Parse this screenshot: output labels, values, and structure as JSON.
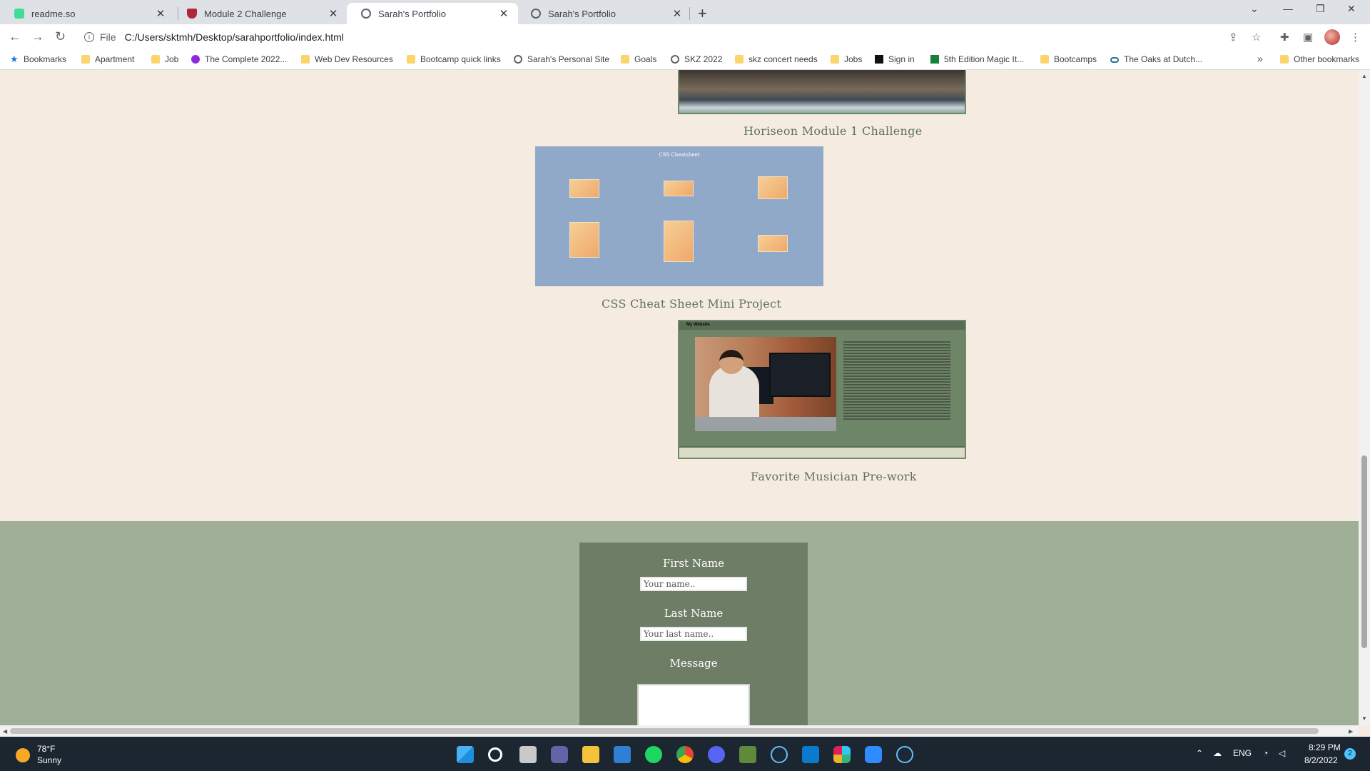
{
  "browser": {
    "tabs": [
      {
        "title": "readme.so",
        "icon": "readme-icon"
      },
      {
        "title": "Module 2 Challenge",
        "icon": "shield-icon"
      },
      {
        "title": "Sarah's Portfolio",
        "icon": "globe-icon",
        "active": true
      },
      {
        "title": "Sarah's Portfolio",
        "icon": "globe-icon"
      }
    ],
    "address": {
      "scheme_label": "File",
      "url": "C:/Users/sktmh/Desktop/sarahportfolio/index.html"
    },
    "bookmarks": [
      {
        "label": "Bookmarks",
        "icon": "star-icon"
      },
      {
        "label": "Apartment",
        "icon": "folder-icon"
      },
      {
        "label": "Job",
        "icon": "folder-icon"
      },
      {
        "label": "The Complete 2022...",
        "icon": "purple-logo-icon"
      },
      {
        "label": "Web Dev Resources",
        "icon": "folder-icon"
      },
      {
        "label": "Bootcamp quick links",
        "icon": "folder-icon"
      },
      {
        "label": "Sarah's Personal Site",
        "icon": "globe-icon"
      },
      {
        "label": "Goals",
        "icon": "folder-icon"
      },
      {
        "label": "SKZ 2022",
        "icon": "globe-icon"
      },
      {
        "label": "skz concert needs",
        "icon": "folder-icon"
      },
      {
        "label": "Jobs",
        "icon": "folder-icon"
      },
      {
        "label": "Sign in",
        "icon": "uw-logo-icon"
      },
      {
        "label": "5th Edition Magic It...",
        "icon": "sheets-icon"
      },
      {
        "label": "Bootcamps",
        "icon": "folder-icon"
      },
      {
        "label": "The Oaks at Dutch...",
        "icon": "link-icon"
      }
    ],
    "bookmarks_overflow": "»",
    "other_bookmarks": "Other bookmarks"
  },
  "portfolio": {
    "projects": [
      {
        "caption": "Horiseon Module 1 Challenge"
      },
      {
        "caption": "CSS Cheat Sheet Mini Project"
      },
      {
        "caption": "Favorite Musician Pre-work"
      }
    ],
    "thumb_cheatsheet_title": "CSS Cheatsheet",
    "thumb_site_title": "My Website"
  },
  "contact_form": {
    "first_name_label": "First Name",
    "first_name_placeholder": "Your name..",
    "last_name_label": "Last Name",
    "last_name_placeholder": "Your last name..",
    "message_label": "Message"
  },
  "taskbar": {
    "weather_temp": "78°F",
    "weather_desc": "Sunny",
    "lang": "ENG",
    "time": "8:29 PM",
    "date": "8/2/2022",
    "notification_count": "2"
  },
  "colors": {
    "page_bg": "#f5ebe0",
    "sage_accent": "#6e7d66",
    "footer_bg": "#a0af97"
  }
}
